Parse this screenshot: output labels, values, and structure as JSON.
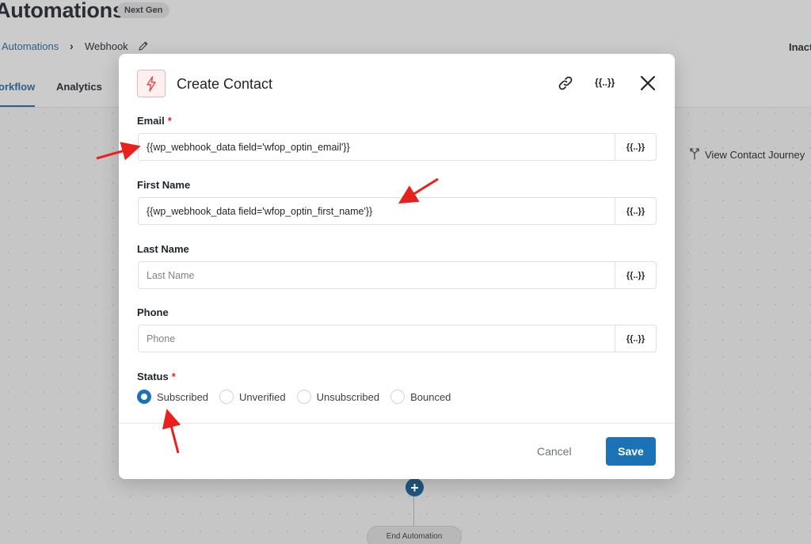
{
  "page": {
    "title": "Automations",
    "badge": "Next Gen",
    "breadcrumb": {
      "root": "Automations",
      "current": "Webhook"
    },
    "status_label": "Inact",
    "tabs": [
      {
        "label": "orkflow"
      },
      {
        "label": "Analytics"
      }
    ],
    "journey_label": "View Contact Journey",
    "end_label": "End Automation",
    "add_symbol": "+"
  },
  "modal": {
    "title": "Create Contact",
    "merge_tag_label": "{{..}}",
    "required_mark": "*",
    "fields": [
      {
        "label": "Email",
        "value": "{{wp_webhook_data field='wfop_optin_email'}}",
        "placeholder": "",
        "required": true
      },
      {
        "label": "First Name",
        "value": "{{wp_webhook_data field='wfop_optin_first_name'}}",
        "placeholder": "",
        "required": false
      },
      {
        "label": "Last Name",
        "value": "",
        "placeholder": "Last Name",
        "required": false
      },
      {
        "label": "Phone",
        "value": "",
        "placeholder": "Phone",
        "required": false
      }
    ],
    "status": {
      "label": "Status",
      "options": [
        {
          "label": "Subscribed",
          "checked": true
        },
        {
          "label": "Unverified",
          "checked": false
        },
        {
          "label": "Unsubscribed",
          "checked": false
        },
        {
          "label": "Bounced",
          "checked": false
        }
      ]
    },
    "buttons": {
      "cancel": "Cancel",
      "save": "Save"
    }
  },
  "colors": {
    "accent": "#1b73b5",
    "required": "#e02424",
    "annotation_arrow": "#e8211d",
    "icon_accent": "#e5484d"
  },
  "icons": [
    "bolt-icon",
    "link-icon",
    "merge-tag-icon",
    "close-icon",
    "edit-icon",
    "journey-icon",
    "chevron-right-icon",
    "plus-icon"
  ]
}
